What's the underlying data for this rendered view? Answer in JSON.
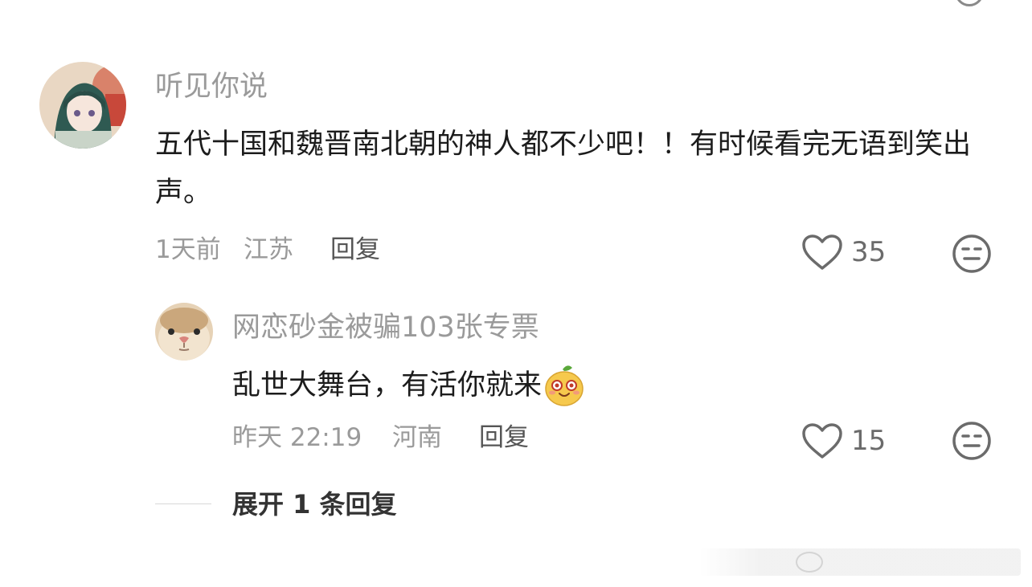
{
  "comments": [
    {
      "username": "听见你说",
      "text": "五代十国和魏晋南北朝的神人都不少吧！！有时候看完无语到笑出声。",
      "time": "1天前",
      "location": "江苏",
      "reply_label": "回复",
      "likes": "35",
      "avatar_icon": "anime-girl-avatar"
    }
  ],
  "replies": [
    {
      "username": "网恋砂金被骗103张专票",
      "text": "乱世大舞台，有活你就来",
      "emoji": "yellow-bun-emoji",
      "time": "昨天 22:19",
      "location": "河南",
      "reply_label": "回复",
      "likes": "15",
      "avatar_icon": "cat-avatar"
    }
  ],
  "expand_label": "展开 1 条回复",
  "colors": {
    "username": "#9a9a9a",
    "text": "#1c1c1c",
    "meta": "#9a9a9a",
    "icon": "#6b6b6b"
  }
}
